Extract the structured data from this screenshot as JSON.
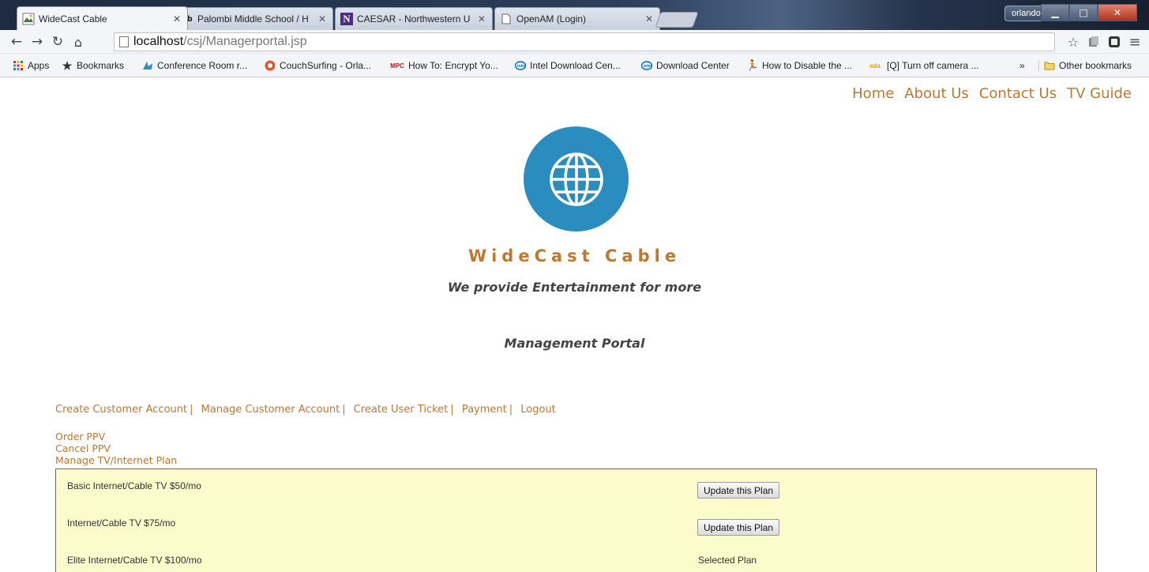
{
  "browser": {
    "tabs": [
      {
        "title": "WideCast Cable",
        "favicon": "widecast-favicon",
        "active": true
      },
      {
        "title": "Palombi Middle School / H",
        "favicon": "Bb"
      },
      {
        "title": "CAESAR - Northwestern U",
        "favicon": "N"
      },
      {
        "title": "OpenAM (Login)",
        "favicon": "page-icon"
      }
    ],
    "profile_name": "orlando",
    "url_host": "localhost",
    "url_path": "/csj/Managerportal.jsp",
    "bookmarks": [
      {
        "label": "Apps"
      },
      {
        "label": "Bookmarks"
      },
      {
        "label": "Conference Room r..."
      },
      {
        "label": "CouchSurfing - Orla..."
      },
      {
        "label": "How To: Encrypt Yo..."
      },
      {
        "label": "Intel Download Cen..."
      },
      {
        "label": "Download Center"
      },
      {
        "label": "How to Disable the ..."
      },
      {
        "label": "[Q] Turn off camera ..."
      }
    ],
    "overflow_label": "»",
    "other_bookmarks": "Other bookmarks"
  },
  "nav": {
    "home": "Home",
    "about": "About Us",
    "contact": "Contact Us",
    "tvguide": "TV Guide"
  },
  "brand": {
    "name": "WideCast Cable",
    "tagline": "We provide Entertainment for more",
    "logo_color": "#2b8cc0",
    "accent_color": "#c0772e"
  },
  "portal": {
    "title": "Management Portal",
    "actions": [
      "Create Customer Account",
      "Manage Customer Account",
      "Create User Ticket",
      "Payment",
      "Logout"
    ],
    "sublinks": [
      "Order PPV",
      "Cancel PPV",
      "Manage TV/Internet Plan"
    ]
  },
  "plans": [
    {
      "name": "Basic Internet/Cable TV $50/mo",
      "action": "Update this Plan"
    },
    {
      "name": "Internet/Cable TV $75/mo",
      "action": "Update this Plan"
    },
    {
      "name": "Elite Internet/Cable TV $100/mo",
      "status": "Selected Plan"
    }
  ]
}
